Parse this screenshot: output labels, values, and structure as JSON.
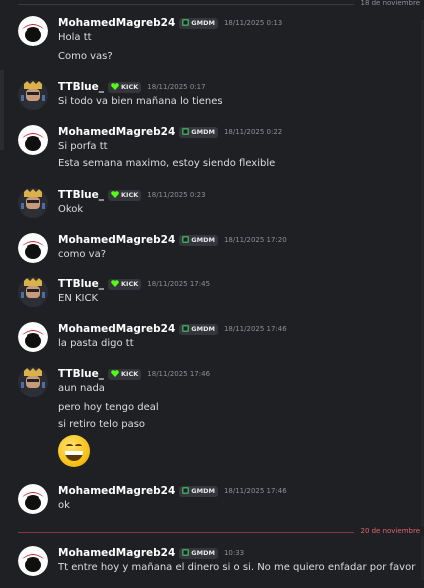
{
  "dividers": {
    "top_label": "18 de noviembre",
    "new_label": "20 de noviembre"
  },
  "tags": {
    "gmdm": "GMDM",
    "kick": "KICK"
  },
  "messages": [
    {
      "user": "MohamedMagreb24",
      "tag": "gmdm",
      "time": "18/11/2025 0:13",
      "lines": [
        "Hola tt",
        "Como vas?"
      ]
    },
    {
      "user": "TTBlue_",
      "tag": "kick",
      "time": "18/11/2025 0:17",
      "lines": [
        "Si todo va bien mañana lo tienes"
      ]
    },
    {
      "user": "MohamedMagreb24",
      "tag": "gmdm",
      "time": "18/11/2025 0:22",
      "lines": [
        "Si porfa tt",
        "Esta semana maximo, estoy siendo flexible"
      ]
    },
    {
      "user": "TTBlue_",
      "tag": "kick",
      "time": "18/11/2025 0:23",
      "lines": [
        "Okok"
      ]
    },
    {
      "user": "MohamedMagreb24",
      "tag": "gmdm",
      "time": "18/11/2025 17:20",
      "lines": [
        "como va?"
      ]
    },
    {
      "user": "TTBlue_",
      "tag": "kick",
      "time": "18/11/2025 17:45",
      "lines": [
        "EN KICK"
      ]
    },
    {
      "user": "MohamedMagreb24",
      "tag": "gmdm",
      "time": "18/11/2025 17:46",
      "lines": [
        "la pasta digo tt"
      ]
    },
    {
      "user": "TTBlue_",
      "tag": "kick",
      "time": "18/11/2025 17:46",
      "lines": [
        "aun nada",
        "pero hoy tengo deal",
        "si retiro telo paso"
      ],
      "emoji": "grinning-face"
    },
    {
      "user": "MohamedMagreb24",
      "tag": "gmdm",
      "time": "18/11/2025 17:46",
      "lines": [
        "ok"
      ]
    },
    {
      "user": "MohamedMagreb24",
      "tag": "gmdm",
      "time": "10:33",
      "lines": [
        "Tt entre hoy y mañana el dinero si o si. No me quiero enfadar por favor"
      ]
    }
  ],
  "colors": {
    "background": "#1f2023",
    "new_divider": "#e0636e",
    "kick_heart": "#53fc18",
    "gmdm_icon": "#3ba55c"
  }
}
